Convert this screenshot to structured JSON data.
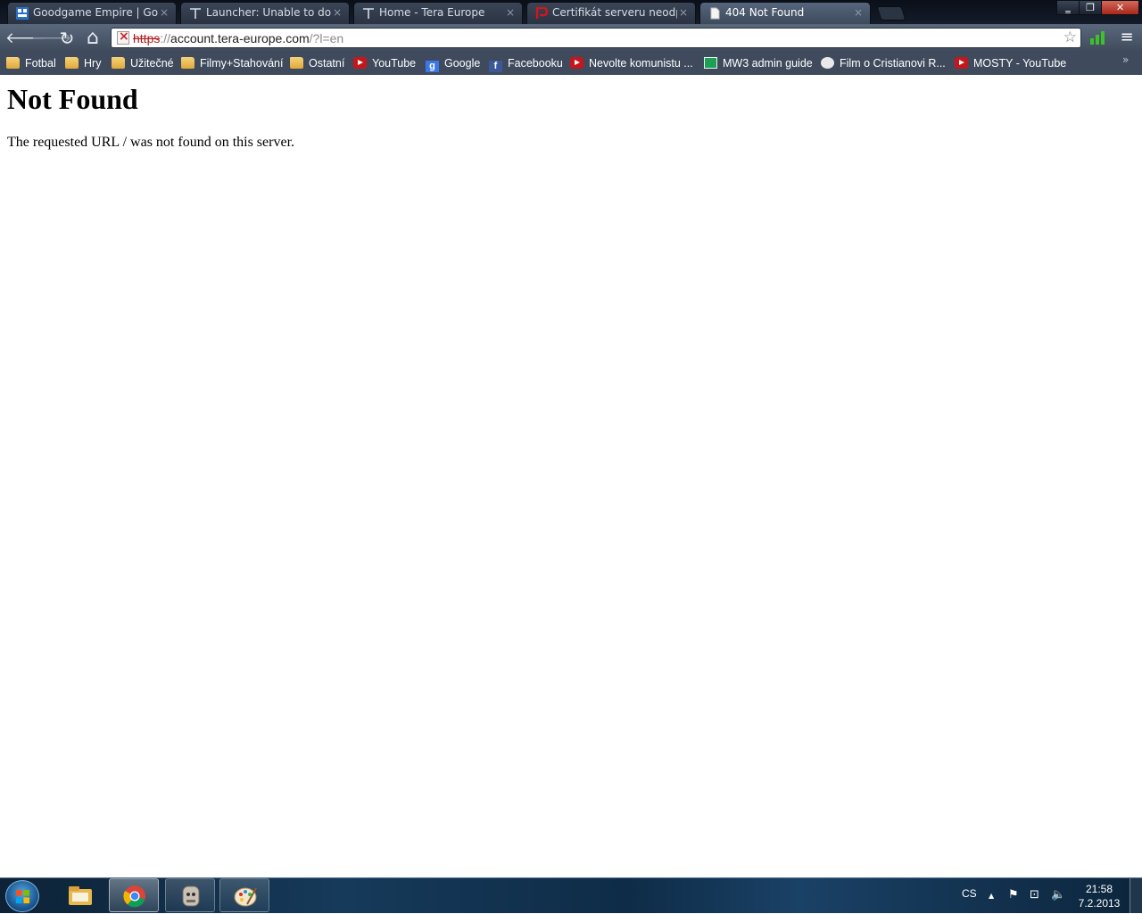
{
  "tabs": [
    {
      "title": "Goodgame Empire | Good",
      "icon": "goodgame-icon",
      "active": false
    },
    {
      "title": "Launcher: Unable to down",
      "icon": "tera-icon",
      "active": false
    },
    {
      "title": "Home - Tera Europe",
      "icon": "tera-icon",
      "active": false
    },
    {
      "title": "Certifikát serveru neodpo",
      "icon": "p-logo-icon",
      "active": false
    },
    {
      "title": "404 Not Found",
      "icon": "page-icon",
      "active": true
    }
  ],
  "omnibox": {
    "scheme": "https",
    "separator": "://",
    "host": "account.tera-europe.com",
    "path": "/?l=en"
  },
  "bookmarks": [
    {
      "label": "Fotbal",
      "icon": "folder"
    },
    {
      "label": "Hry",
      "icon": "folder"
    },
    {
      "label": "Užitečné",
      "icon": "folder"
    },
    {
      "label": "Filmy+Stahování",
      "icon": "folder"
    },
    {
      "label": "Ostatní",
      "icon": "folder"
    },
    {
      "label": "YouTube",
      "icon": "youtube"
    },
    {
      "label": "Google",
      "icon": "google"
    },
    {
      "label": "Facebooku",
      "icon": "facebook"
    },
    {
      "label": "Nevolte komunistu ...",
      "icon": "youtube"
    },
    {
      "label": "MW3 admin guide",
      "icon": "spreadsheet"
    },
    {
      "label": "Film o Cristianovi R...",
      "icon": "real-madrid"
    },
    {
      "label": "MOSTY - YouTube",
      "icon": "youtube"
    }
  ],
  "page": {
    "heading": "Not Found",
    "message": "The requested URL / was not found on this server."
  },
  "taskbar": {
    "apps": [
      "explorer",
      "chrome",
      "game-launcher",
      "paint"
    ],
    "language": "CS",
    "time": "21:58",
    "date": "7.2.2013"
  },
  "glyphs": {
    "back": "🡐",
    "forward": "🡒",
    "reload": "↻",
    "home": "⌂",
    "star": "☆",
    "menu": "≡",
    "close": "×",
    "minimize": "‗",
    "restore": "❐",
    "window_close": "✕",
    "security_x": "×",
    "bookmarks_more": "»",
    "tray_up": "▲",
    "tray_flag": "⚑",
    "tray_network": "⊡",
    "tray_volume": "🔈"
  },
  "colors": {
    "chrome_frame": "#202a37",
    "toolbar": "#4a586b",
    "https_struck": "#b01a1a",
    "taskbar": "#163a5a"
  }
}
